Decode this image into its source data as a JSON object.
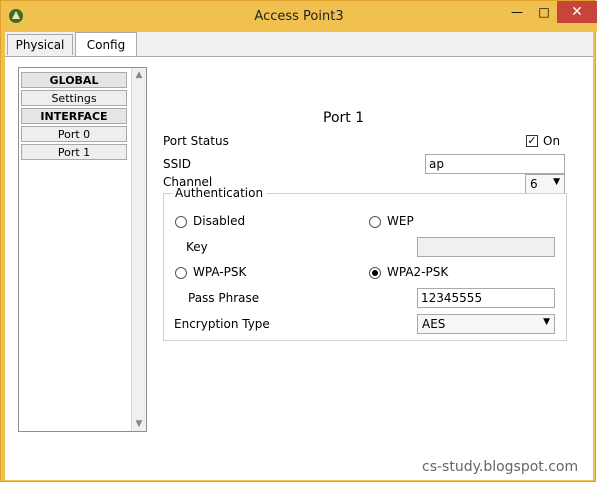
{
  "window": {
    "title": "Access Point3",
    "minimize_label": "—",
    "maximize_label": "□",
    "close_label": "✕",
    "app_icon": "packet-tracer-icon"
  },
  "tabs": [
    {
      "label": "Physical"
    },
    {
      "label": "Config"
    }
  ],
  "sidebar": {
    "items": [
      {
        "label": "GLOBAL"
      },
      {
        "label": "Settings"
      },
      {
        "label": "INTERFACE"
      },
      {
        "label": "Port 0"
      },
      {
        "label": "Port 1"
      }
    ]
  },
  "port": {
    "title": "Port 1",
    "status_label": "Port Status",
    "status_checked_label": "On",
    "ssid_label": "SSID",
    "ssid_value": "ap",
    "channel_label": "Channel",
    "channel_value": "6"
  },
  "authentication": {
    "legend": "Authentication",
    "options": [
      {
        "label": "Disabled"
      },
      {
        "label": "WEP"
      },
      {
        "label": "WPA-PSK"
      },
      {
        "label": "WPA2-PSK"
      }
    ],
    "selected": "WPA2-PSK",
    "key_label": "Key",
    "key_value": "",
    "passphrase_label": "Pass Phrase",
    "passphrase_value": "12345555",
    "encryption_label": "Encryption Type",
    "encryption_value": "AES"
  },
  "watermark": "cs-study.blogspot.com",
  "colors": {
    "titlebar": "#f0c14f",
    "close_button": "#c8433a"
  }
}
